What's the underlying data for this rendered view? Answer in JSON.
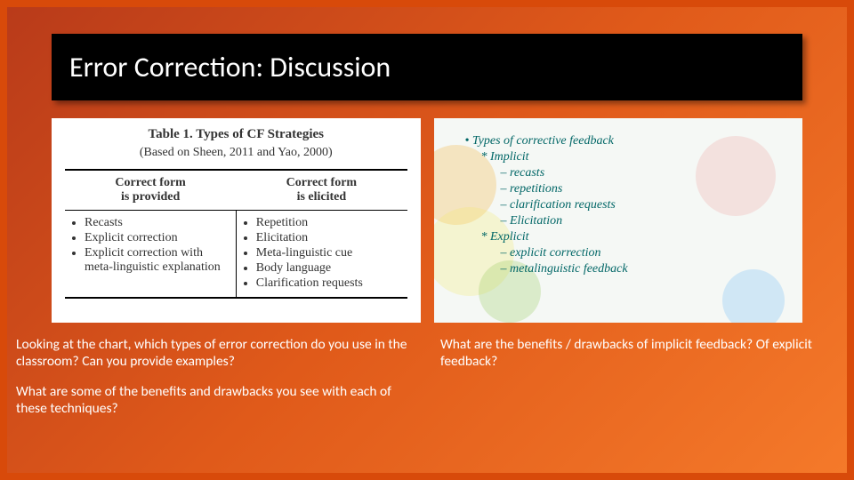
{
  "title": "Error Correction: Discussion",
  "table": {
    "caption_line1": "Table 1. Types of CF Strategies",
    "caption_line2": "(Based on Sheen, 2011 and Yao, 2000)",
    "header_left_l1": "Correct form",
    "header_left_l2": "is provided",
    "header_right_l1": "Correct form",
    "header_right_l2": "is elicited",
    "left": [
      "Recasts",
      "Explicit correction",
      "Explicit correction with meta-linguistic explanation"
    ],
    "right": [
      "Repetition",
      "Elicitation",
      "Meta-linguistic cue",
      "Body language",
      "Clarification requests"
    ]
  },
  "feedback_panel": {
    "heading": "• Types of corrective feedback",
    "implicit_label": "* Implicit",
    "implicit_items": [
      "– recasts",
      "– repetitions",
      "– clarification requests",
      "– Elicitation"
    ],
    "explicit_label": "* Explicit",
    "explicit_items": [
      "– explicit correction",
      "– metalinguistic feedback"
    ]
  },
  "questions": {
    "q1": "Looking at the chart, which types of error correction do you use in the classroom? Can you provide examples?",
    "q2": "What are some of the benefits and drawbacks you see with each of these techniques?",
    "q3": "What are the benefits / drawbacks of implicit feedback? Of explicit feedback?"
  }
}
